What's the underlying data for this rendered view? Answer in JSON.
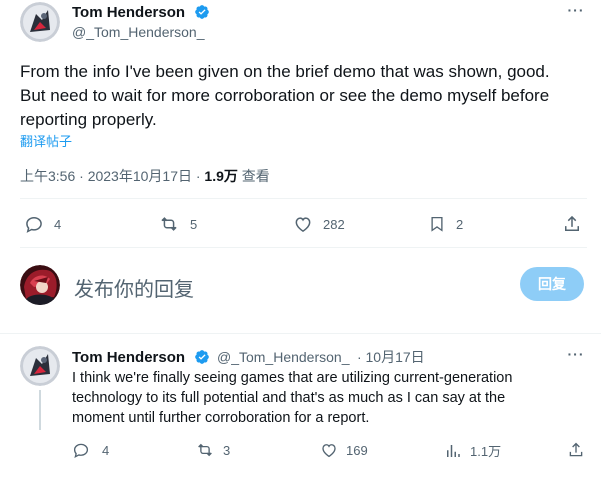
{
  "main_tweet": {
    "author_name": "Tom Henderson",
    "author_handle": "@_Tom_Henderson_",
    "more_label": "···",
    "text_line1": "From the info I've been given on the brief demo that was shown, good.",
    "text_line2": "But need to wait for more corroboration or see the demo myself before",
    "text_line3": "reporting properly.",
    "translate_label": "翻译帖子",
    "time": "上午3:56 · 2023年10月17日 · ",
    "views_count": "1.9万",
    "views_label": " 查看",
    "actions": {
      "reply_count": "4",
      "retweet_count": "5",
      "like_count": "282",
      "bookmark_count": "2"
    }
  },
  "compose": {
    "placeholder": "发布你的回复",
    "reply_button": "回复"
  },
  "reply_tweet": {
    "author_name": "Tom Henderson",
    "author_handle": "@_Tom_Henderson_",
    "date": "· 10月17日",
    "more_label": "···",
    "text_line1": "I think we're finally seeing games that are utilizing current-generation",
    "text_line2": "technology to its full potential and that's as much as I can say at the",
    "text_line3": "moment until further corroboration for a report.",
    "actions": {
      "reply_count": "4",
      "retweet_count": "3",
      "like_count": "169",
      "views_count": "1.1万"
    }
  },
  "colors": {
    "accent": "#1d9bf0",
    "reply_button_disabled": "#8ecdf7",
    "secondary_text": "#536471",
    "divider": "#eff3f4"
  }
}
